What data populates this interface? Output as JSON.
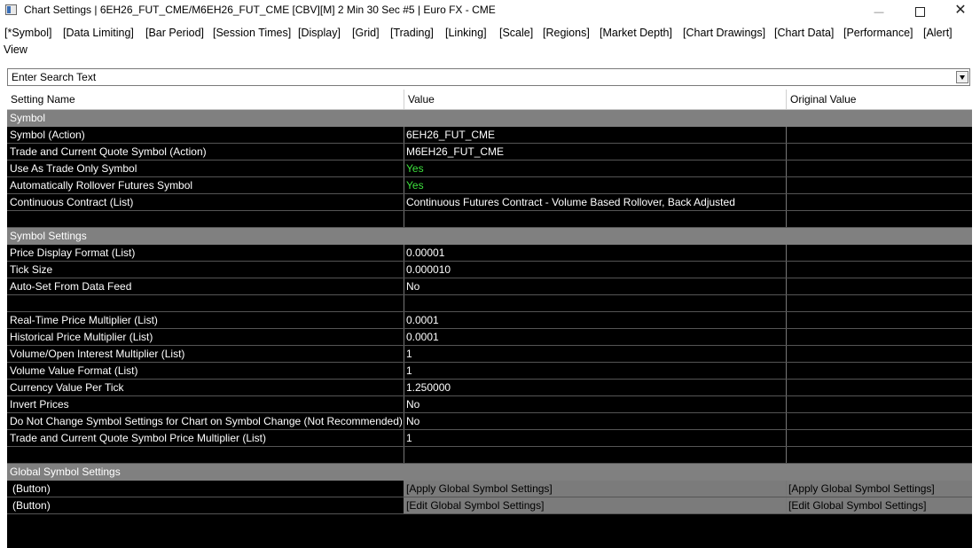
{
  "window": {
    "title": "Chart Settings | 6EH26_FUT_CME/M6EH26_FUT_CME [CBV][M]  2 Min 30 Sec  #5 | Euro FX - CME",
    "minimize": "—",
    "close": "✕"
  },
  "menu": [
    "[*Symbol]",
    "[Data Limiting]",
    "[Bar Period]",
    "[Session Times]",
    "[Display]",
    "[Grid]",
    "[Trading]",
    "[Linking]",
    "[Scale]",
    "[Regions]",
    "[Market Depth]",
    "[Chart Drawings]",
    "[Chart Data]",
    "[Performance]",
    "[Alert]",
    "View"
  ],
  "search": {
    "text": "Enter Search Text"
  },
  "columns": {
    "name": "Setting Name",
    "value": "Value",
    "original": "Original Value"
  },
  "rows": [
    {
      "type": "section",
      "name": "Symbol",
      "value": "",
      "original": ""
    },
    {
      "type": "setting",
      "name": "Symbol (Action)",
      "value": "6EH26_FUT_CME",
      "original": ""
    },
    {
      "type": "setting",
      "name": "Trade and Current Quote Symbol (Action)",
      "value": "M6EH26_FUT_CME",
      "original": ""
    },
    {
      "type": "setting",
      "name": "Use As Trade Only Symbol",
      "value": "Yes",
      "original": "",
      "highlight": "#3ee23e"
    },
    {
      "type": "setting",
      "name": "Automatically Rollover Futures Symbol",
      "value": "Yes",
      "original": "",
      "highlight": "#3ee23e"
    },
    {
      "type": "setting",
      "name": "Continuous Contract (List)",
      "value": "Continuous Futures Contract - Volume Based Rollover, Back Adjusted",
      "original": ""
    },
    {
      "type": "blank",
      "name": "",
      "value": "",
      "original": ""
    },
    {
      "type": "section",
      "name": "Symbol Settings",
      "value": "",
      "original": ""
    },
    {
      "type": "setting",
      "name": "Price Display Format (List)",
      "value": "0.00001",
      "original": ""
    },
    {
      "type": "setting",
      "name": "Tick Size",
      "value": "0.000010",
      "original": ""
    },
    {
      "type": "setting",
      "name": "Auto-Set From Data Feed",
      "value": "No",
      "original": ""
    },
    {
      "type": "blank",
      "name": "",
      "value": "",
      "original": ""
    },
    {
      "type": "setting",
      "name": "Real-Time Price Multiplier (List)",
      "value": "0.0001",
      "original": ""
    },
    {
      "type": "setting",
      "name": "Historical Price Multiplier (List)",
      "value": "0.0001",
      "original": ""
    },
    {
      "type": "setting",
      "name": "Volume/Open Interest Multiplier (List)",
      "value": "1",
      "original": ""
    },
    {
      "type": "setting",
      "name": "Volume Value Format (List)",
      "value": "1",
      "original": ""
    },
    {
      "type": "setting",
      "name": "Currency Value Per Tick",
      "value": "1.250000",
      "original": ""
    },
    {
      "type": "setting",
      "name": "Invert Prices",
      "value": "No",
      "original": ""
    },
    {
      "type": "setting",
      "name": "Do Not Change Symbol Settings for Chart on Symbol Change (Not Recommended)",
      "value": "No",
      "original": ""
    },
    {
      "type": "setting",
      "name": "Trade and Current Quote Symbol Price Multiplier (List)",
      "value": "1",
      "original": ""
    },
    {
      "type": "blank",
      "name": "",
      "value": "",
      "original": ""
    },
    {
      "type": "section",
      "name": "Global Symbol Settings",
      "value": "",
      "original": ""
    },
    {
      "type": "button",
      "name": "(Button)",
      "value": "[Apply Global Symbol Settings]",
      "original": "[Apply Global Symbol Settings]"
    },
    {
      "type": "button",
      "name": "(Button)",
      "value": "[Edit Global Symbol Settings]",
      "original": "[Edit Global Symbol Settings]"
    }
  ]
}
